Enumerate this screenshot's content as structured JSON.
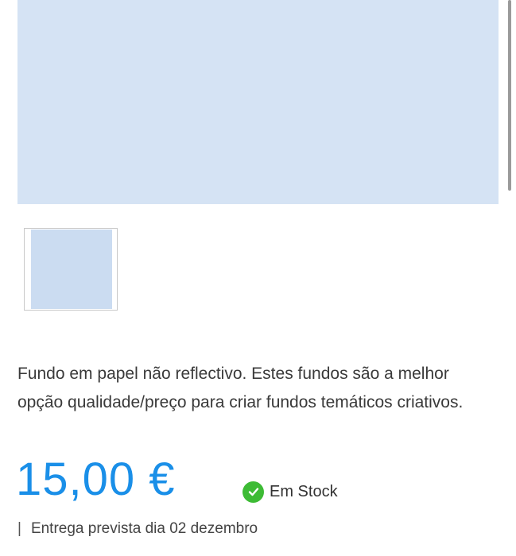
{
  "product": {
    "description": "Fundo em papel não reflectivo. Estes fundos são a melhor opção qualidade/preço para criar fundos temáticos criativos.",
    "price": "15,00 €",
    "stock_status": "Em Stock",
    "delivery_separator": "|",
    "delivery_text": "Entrega prevista dia 02 dezembro",
    "image_color": "#d5e3f4"
  },
  "colors": {
    "price": "#1a8fe8",
    "stock_check": "#3dbb35"
  },
  "icons": {
    "stock": "check-circle-icon"
  }
}
